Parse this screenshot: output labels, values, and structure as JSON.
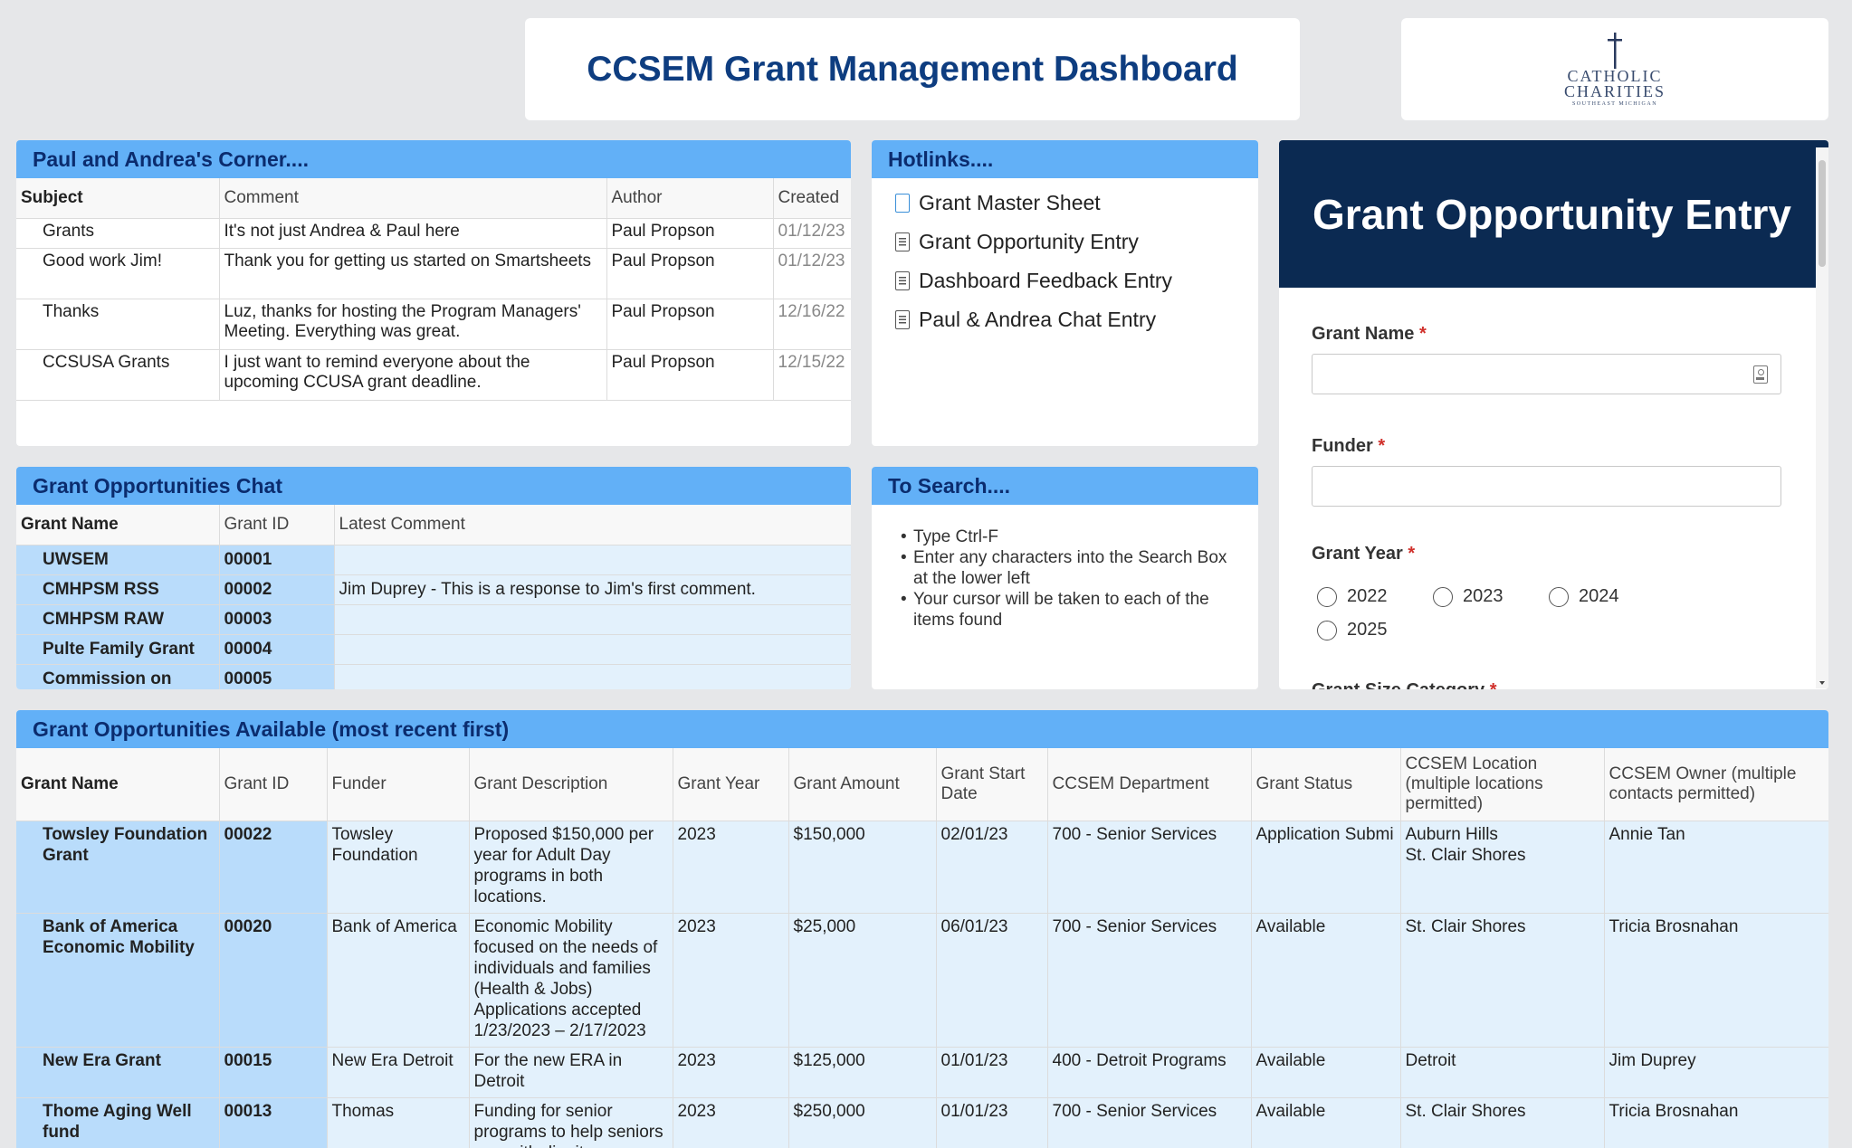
{
  "header": {
    "title": "CCSEM Grant Management Dashboard"
  },
  "logo": {
    "line1": "CATHOLIC",
    "line2": "CHARITIES",
    "line3": "SOUTHEAST MICHIGAN"
  },
  "corner": {
    "title": "Paul and Andrea's Corner....",
    "columns": [
      "Subject",
      "Comment",
      "Author",
      "Created"
    ],
    "rows": [
      {
        "subject": "Grants",
        "comment": "It's not just Andrea & Paul here",
        "author": "Paul Propson",
        "created": "01/12/23"
      },
      {
        "subject": "Good work Jim!",
        "comment": "Thank you for getting us started on Smartsheets",
        "author": "Paul Propson",
        "created": "01/12/23"
      },
      {
        "subject": "Thanks",
        "comment": "Luz, thanks for hosting the Program Managers' Meeting. Everything was great.",
        "author": "Paul Propson",
        "created": "12/16/22"
      },
      {
        "subject": "CCSUSA Grants",
        "comment": "I just want to remind everyone about the upcoming CCUSA grant deadline.",
        "author": "Paul Propson",
        "created": "12/15/22"
      }
    ]
  },
  "hotlinks": {
    "title": "Hotlinks....",
    "items": [
      {
        "label": "Grant Master Sheet",
        "icon": "sheet-icon"
      },
      {
        "label": "Grant Opportunity Entry",
        "icon": "form-icon"
      },
      {
        "label": "Dashboard Feedback Entry",
        "icon": "form-icon"
      },
      {
        "label": "Paul & Andrea Chat Entry",
        "icon": "form-icon"
      }
    ]
  },
  "chat": {
    "title": "Grant Opportunities Chat",
    "columns": [
      "Grant Name",
      "Grant ID",
      "Latest Comment"
    ],
    "rows": [
      {
        "name": "UWSEM",
        "id": "00001",
        "comment": ""
      },
      {
        "name": "CMHPSM RSS",
        "id": "00002",
        "comment": "Jim Duprey - This is a response to Jim's first comment."
      },
      {
        "name": "CMHPSM RAW",
        "id": "00003",
        "comment": ""
      },
      {
        "name": "Pulte Family Grant",
        "id": "00004",
        "comment": ""
      },
      {
        "name": "Commission on",
        "id": "00005",
        "comment": ""
      }
    ]
  },
  "search": {
    "title": "To Search....",
    "items": [
      "Type Ctrl-F",
      "Enter any characters into the Search Box at the lower left",
      "Your cursor will be taken to each of the items found"
    ]
  },
  "form": {
    "title": "Grant Opportunity Entry",
    "grant_name_label": "Grant Name",
    "funder_label": "Funder",
    "grant_year_label": "Grant Year",
    "required_mark": "*",
    "years": [
      "2022",
      "2023",
      "2024",
      "2025"
    ],
    "size_category_label": "Grant Size Category"
  },
  "grants": {
    "title": "Grant Opportunities Available  (most recent first)",
    "columns": [
      "Grant Name",
      "Grant ID",
      "Funder",
      "Grant Description",
      "Grant Year",
      "Grant Amount",
      "Grant Start Date",
      "CCSEM Department",
      "Grant Status",
      "CCSEM Location (multiple locations permitted)",
      "CCSEM Owner (multiple contacts permitted)"
    ],
    "rows": [
      {
        "name": "Towsley Foundation Grant",
        "id": "00022",
        "funder": "Towsley Foundation",
        "description": "Proposed $150,000 per year for Adult Day programs in both locations.",
        "year": "2023",
        "amount": "$150,000",
        "start": "02/01/23",
        "department": "700 - Senior Services",
        "status": "Application Submi",
        "location": "Auburn Hills\nSt. Clair Shores",
        "owner": "Annie Tan"
      },
      {
        "name": "Bank of America Economic Mobility",
        "id": "00020",
        "funder": "Bank of America",
        "description": "Economic Mobility focused on the needs of individuals and families (Health & Jobs) Applications accepted 1/23/2023 – 2/17/2023",
        "year": "2023",
        "amount": "$25,000",
        "start": "06/01/23",
        "department": "700 - Senior Services",
        "status": "Available",
        "location": "St. Clair Shores",
        "owner": "Tricia Brosnahan"
      },
      {
        "name": "New Era Grant",
        "id": "00015",
        "funder": "New Era Detroit",
        "description": "For the new ERA in Detroit",
        "year": "2023",
        "amount": "$125,000",
        "start": "01/01/23",
        "department": "400 - Detroit Programs",
        "status": "Available",
        "location": "Detroit",
        "owner": "Jim Duprey"
      },
      {
        "name": "Thome Aging Well fund",
        "id": "00013",
        "funder": "Thomas",
        "description": "Funding for senior programs to help seniors age with dignity",
        "year": "2023",
        "amount": "$250,000",
        "start": "01/01/23",
        "department": "700 - Senior Services",
        "status": "Available",
        "location": "St. Clair Shores",
        "owner": "Tricia Brosnahan"
      }
    ]
  },
  "colors": {
    "panel_header": "#62b0f7",
    "header_text": "#0b2c6e",
    "form_hero": "#0b2a52",
    "name_col": "#b9dcfb",
    "row_bg": "#e3f1fc"
  }
}
